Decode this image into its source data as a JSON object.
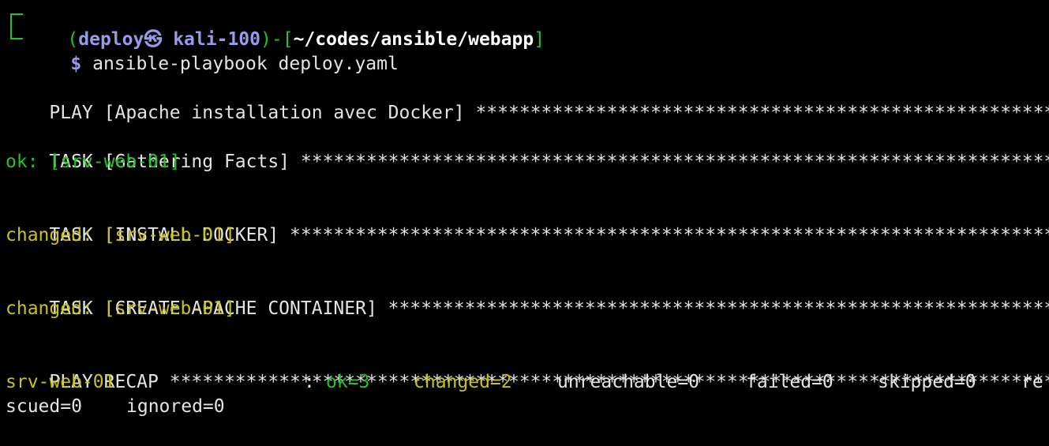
{
  "prompt": {
    "open_paren": "(",
    "user": "deploy",
    "at_symbol": "㉿",
    "host": "kali-100",
    "close_paren": ")",
    "dash": "-",
    "open_bracket": "[",
    "path": "~/codes/ansible/webapp",
    "close_bracket": "]",
    "dollar": "$",
    "command": "ansible-playbook deploy.yaml"
  },
  "output": {
    "play_header": "PLAY [Apache installation avec Docker] ",
    "play_stars": "****************************************************************************",
    "task1_header": "TASK [Gathering Facts] ",
    "task1_stars": "****************************************************************************************************",
    "task1_result": "ok: [srv-web-01]",
    "task2_header": "TASK [INSTALL DOCKER] ",
    "task2_stars": "****************************************************************************************************",
    "task2_result": "changed: [srv-web-01]",
    "task3_header": "TASK [CREATE APACHE CONTAINER] ",
    "task3_stars": "****************************************************************************************************",
    "task3_result": "changed: [srv-web-01]",
    "recap_header": "PLAY RECAP ",
    "recap_stars": "****************************************************************************************************"
  },
  "recap": {
    "host": "srv-web-01",
    "colon": ": ",
    "ok": "ok=3",
    "changed": "changed=2",
    "unreachable": "unreachable=0",
    "failed": "failed=0",
    "skipped": "skipped=0",
    "wrap_start": "re",
    "wrap_end": "scued=0",
    "ignored": "ignored=0"
  },
  "colors": {
    "background": "#000000",
    "text": "#e4e4e4",
    "ok_green": "#22c22c",
    "changed_yellow": "#c9c11d",
    "prompt_lavender": "#9a9aea"
  }
}
